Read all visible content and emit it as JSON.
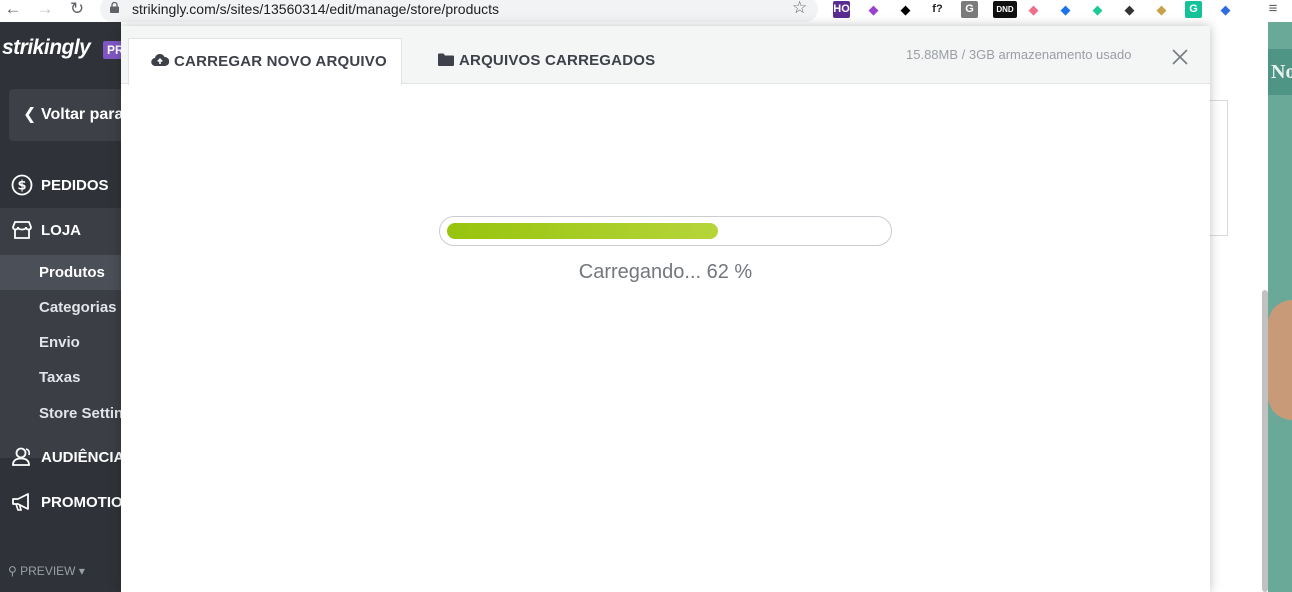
{
  "browser": {
    "url": "strikingly.com/s/sites/13560314/edit/manage/store/products",
    "extensions": [
      {
        "name": "honey",
        "label": "HO",
        "bg": "#5a2d91",
        "fg": "#ffffff"
      },
      {
        "name": "quill",
        "label": "",
        "bg": "",
        "fg": "#9b3fd1"
      },
      {
        "name": "qr-code",
        "label": "",
        "bg": "",
        "fg": "#000000"
      },
      {
        "name": "font-finder",
        "label": "f?",
        "bg": "",
        "fg": "#222222"
      },
      {
        "name": "g-ext",
        "label": "G",
        "bg": "#7b7b7b",
        "fg": "#ffffff"
      },
      {
        "name": "dnd",
        "label": "DND",
        "bg": "#111111",
        "fg": "#ffffff"
      },
      {
        "name": "pink-ext",
        "label": "",
        "bg": "",
        "fg": "#f06e8a"
      },
      {
        "name": "eyedropper",
        "label": "",
        "bg": "",
        "fg": "#1a73e8"
      },
      {
        "name": "figure",
        "label": "",
        "bg": "",
        "fg": "#20c997"
      },
      {
        "name": "hexagon",
        "label": "",
        "bg": "",
        "fg": "#333333"
      },
      {
        "name": "paint",
        "label": "",
        "bg": "",
        "fg": "#c8a14b"
      },
      {
        "name": "grammarly",
        "label": "G",
        "bg": "#15c39a",
        "fg": "#ffffff"
      },
      {
        "name": "feather",
        "label": "",
        "bg": "",
        "fg": "#2f6de1"
      }
    ]
  },
  "sidebar": {
    "logo": "strikingly",
    "badge": "PRO",
    "back_label": "Voltar para o editor",
    "nav": {
      "pedidos": "PEDIDOS",
      "loja": "LOJA",
      "audiencia": "AUDIÊNCIA",
      "promotions": "PROMOTIONS"
    },
    "store_items": [
      "Produtos",
      "Categorias",
      "Envio",
      "Taxas",
      "Store Settings"
    ],
    "preview": "PREVIEW"
  },
  "background": {
    "banner_text": "No"
  },
  "modal": {
    "tabs": {
      "upload": "CARREGAR NOVO ARQUIVO",
      "uploaded": "ARQUIVOS CARREGADOS"
    },
    "storage": "15.88MB / 3GB armazenamento usado",
    "progress_fraction": 0.62,
    "progress_text": "Carregando... 62 %"
  },
  "colors": {
    "sidebar_bg": "#2f3238",
    "progress_start": "#97c40d",
    "progress_end": "#b6d53a",
    "accent_purple": "#7e57c2"
  }
}
